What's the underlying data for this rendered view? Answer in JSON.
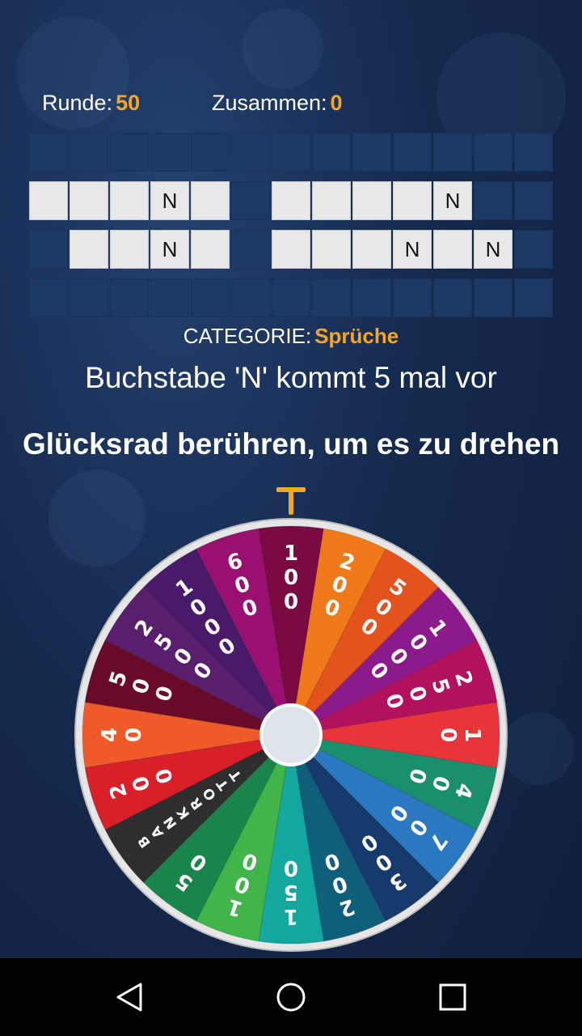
{
  "scores": {
    "round_label": "Runde:",
    "round_value": "50",
    "total_label": "Zusammen:",
    "total_value": "0"
  },
  "board": {
    "rows": [
      [
        "",
        "",
        "",
        "",
        "",
        "",
        "",
        "",
        "",
        "",
        "",
        "",
        ""
      ],
      [
        "_",
        "_",
        "_",
        "N",
        "_",
        "",
        "_",
        "_",
        "_",
        "_",
        "N",
        "",
        ""
      ],
      [
        "",
        "_",
        "_",
        "N",
        "_",
        "",
        "_",
        "_",
        "_",
        "N",
        "_",
        "N",
        ""
      ],
      [
        "",
        "",
        "",
        "",
        "",
        "",
        "",
        "",
        "",
        "",
        "",
        "",
        ""
      ]
    ]
  },
  "category": {
    "label": "CATEGORIE:",
    "value": "Sprüche"
  },
  "hint": "Buchstabe 'N' kommt 5 mal vor",
  "instruction": "Glücksrad berühren, um es zu drehen",
  "wheel": {
    "segments": [
      {
        "label": "100",
        "color": "#7a0a42"
      },
      {
        "label": "200",
        "color": "#f07a1a"
      },
      {
        "label": "500",
        "color": "#e4521e"
      },
      {
        "label": "1000",
        "color": "#8c1a8c"
      },
      {
        "label": "2500",
        "color": "#b3105e"
      },
      {
        "label": "10",
        "color": "#e8353a"
      },
      {
        "label": "400",
        "color": "#1a8f6e"
      },
      {
        "label": "700",
        "color": "#2b78c0"
      },
      {
        "label": "300",
        "color": "#173a6e"
      },
      {
        "label": "200",
        "color": "#0f5f7a"
      },
      {
        "label": "150",
        "color": "#13a7a0"
      },
      {
        "label": "100",
        "color": "#41b54a"
      },
      {
        "label": "50",
        "color": "#18864a"
      },
      {
        "label": "BANKROTT",
        "color": "#2e2e2e"
      },
      {
        "label": "200",
        "color": "#d91f2a"
      },
      {
        "label": "40",
        "color": "#f05a28"
      },
      {
        "label": "500",
        "color": "#6a0a28"
      },
      {
        "label": "2500",
        "color": "#5a1e6e"
      },
      {
        "label": "1000",
        "color": "#4a1a6a"
      },
      {
        "label": "600",
        "color": "#9a1070"
      }
    ]
  },
  "colors": {
    "accent": "#f5a623"
  },
  "nav": {
    "back_icon": "back-icon",
    "home_icon": "home-icon",
    "recents_icon": "recents-icon"
  }
}
